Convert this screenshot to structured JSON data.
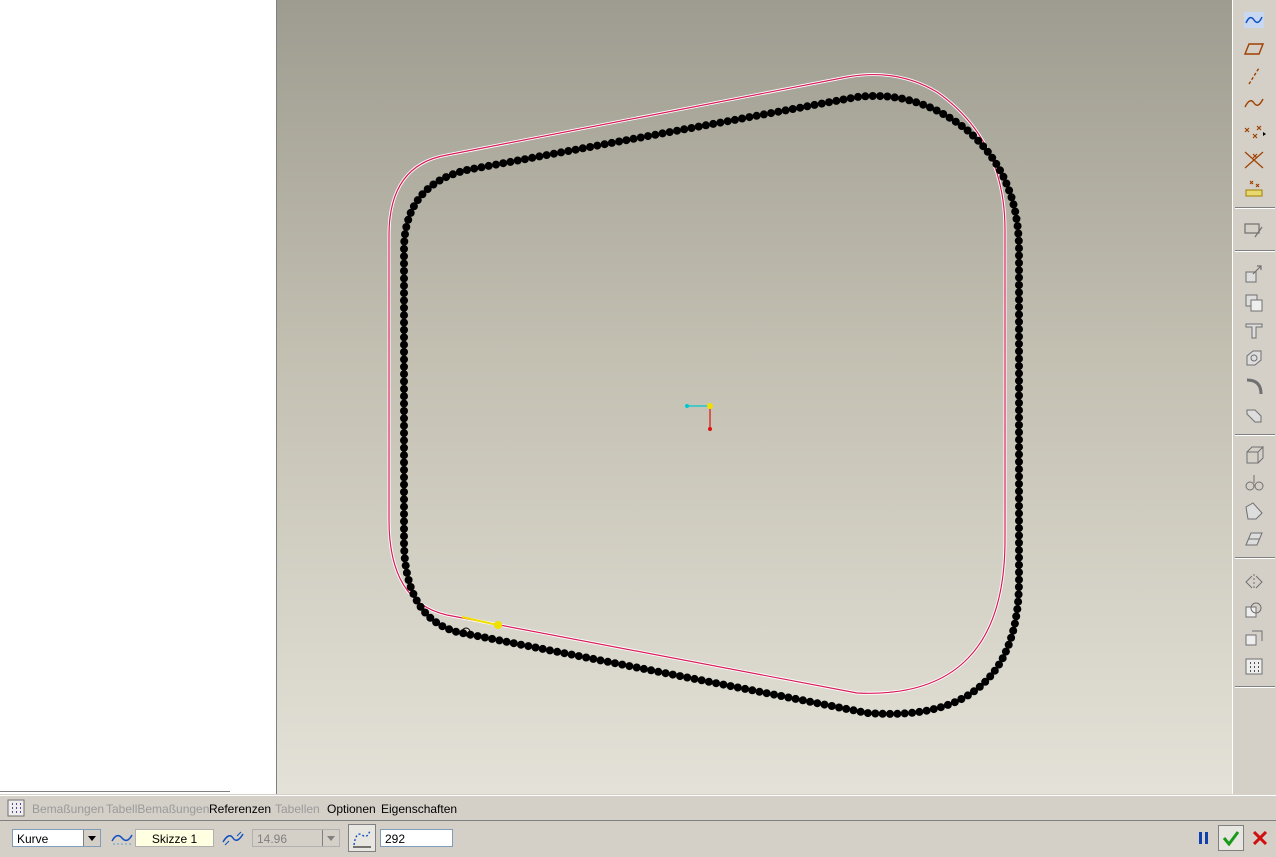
{
  "dashboard": {
    "tabs": [
      {
        "label": "Bemaßungen",
        "enabled": false
      },
      {
        "label": "TabellBemaßungen",
        "enabled": false
      },
      {
        "label": "Referenzen",
        "enabled": true
      },
      {
        "label": "Tabellen",
        "enabled": false
      },
      {
        "label": "Optionen",
        "enabled": true
      },
      {
        "label": "Eigenschaften",
        "enabled": true
      }
    ],
    "type_select": {
      "value": "Kurve"
    },
    "sketch_field": {
      "value": "Skizze 1"
    },
    "spacing_field": {
      "value": "14.96"
    },
    "count_field": {
      "value": "292"
    }
  },
  "right_toolbar": {
    "icons": [
      "sketched-curve-icon",
      "datum-plane-icon",
      "datum-axis-icon",
      "datum-curve-icon",
      "datum-point-icon",
      "point-offset-icon",
      "point-analysis-icon",
      "annotation-icon",
      "extrude-icon",
      "revolve-icon",
      "sweep-icon",
      "blend-icon",
      "hole-icon",
      "round-icon",
      "shell-icon",
      "rib-icon",
      "draft-icon",
      "chamfer-icon",
      "mirror-icon",
      "merge-icon",
      "trim-icon",
      "pattern-icon"
    ]
  },
  "colors": {
    "curve": "#d81b5a",
    "points": "#000000",
    "coord_x": "#00c8d0",
    "coord_y": "#e01010",
    "origin": "#f0e000",
    "accept": "#1a9a1a",
    "cancel": "#d01010",
    "pause": "#1040b0"
  }
}
